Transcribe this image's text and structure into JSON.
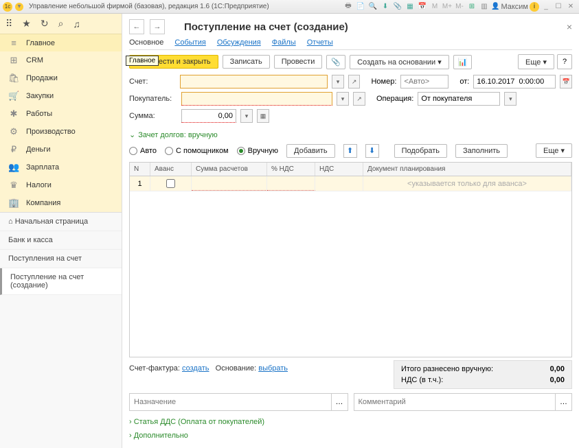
{
  "titlebar": {
    "title": "Управление небольшой фирмой (базовая), редакция 1.6  (1С:Предприятие)",
    "user": "Максим",
    "icons": [
      "M",
      "M+",
      "M-"
    ]
  },
  "sidebar": {
    "items": [
      {
        "icon": "≡",
        "label": "Главное",
        "active": true
      },
      {
        "icon": "⊞",
        "label": "CRM"
      },
      {
        "icon": "🛍",
        "label": "Продажи"
      },
      {
        "icon": "🛒",
        "label": "Закупки"
      },
      {
        "icon": "✱",
        "label": "Работы"
      },
      {
        "icon": "⚙",
        "label": "Производство"
      },
      {
        "icon": "₽",
        "label": "Деньги"
      },
      {
        "icon": "👥",
        "label": "Зарплата"
      },
      {
        "icon": "♛",
        "label": "Налоги"
      },
      {
        "icon": "🏢",
        "label": "Компания"
      }
    ],
    "secondary": [
      {
        "label": "Начальная страница",
        "icon": "⌂"
      },
      {
        "label": "Банк и касса"
      },
      {
        "label": "Поступления на счет"
      },
      {
        "label": "Поступление на счет (создание)",
        "active": true
      }
    ]
  },
  "page": {
    "title": "Поступление на счет (создание)",
    "tabs": [
      "Основное",
      "События",
      "Обсуждения",
      "Файлы",
      "Отчеты"
    ],
    "active_tab": 0
  },
  "toolbar": {
    "tooltip": "Главное",
    "primary": "овести и закрыть",
    "record": "Записать",
    "post": "Провести",
    "create_based": "Создать на основании",
    "more": "Еще",
    "help": "?"
  },
  "form": {
    "account_label": "Счет:",
    "number_label": "Номер:",
    "number_placeholder": "<Авто>",
    "from_label": "от:",
    "date_value": "16.10.2017  0:00:00",
    "buyer_label": "Покупатель:",
    "operation_label": "Операция:",
    "operation_value": "От покупателя",
    "sum_label": "Сумма:",
    "sum_value": "0,00"
  },
  "section": {
    "title": "Зачет долгов: вручную",
    "radio_auto": "Авто",
    "radio_assist": "С помощником",
    "radio_manual": "Вручную",
    "add": "Добавить",
    "pick": "Подобрать",
    "fill": "Заполнить",
    "more": "Еще"
  },
  "table": {
    "headers": [
      "N",
      "Аванс",
      "Сумма расчетов",
      "% НДС",
      "НДС",
      "Документ планирования"
    ],
    "row1_n": "1",
    "row1_doc": "<указывается только для аванса>"
  },
  "totals": {
    "manual_label": "Итого разнесено вручную:",
    "manual_value": "0,00",
    "vat_label": "НДС (в т.ч.):",
    "vat_value": "0,00"
  },
  "bottom": {
    "invoice_label": "Счет-фактура:",
    "create_link": "создать",
    "basis_label": "Основание:",
    "select_link": "выбрать",
    "purpose_placeholder": "Назначение",
    "comment_placeholder": "Комментарий",
    "dds_section": "Статья ДДС (Оплата от покупателей)",
    "additional_section": "Дополнительно"
  }
}
